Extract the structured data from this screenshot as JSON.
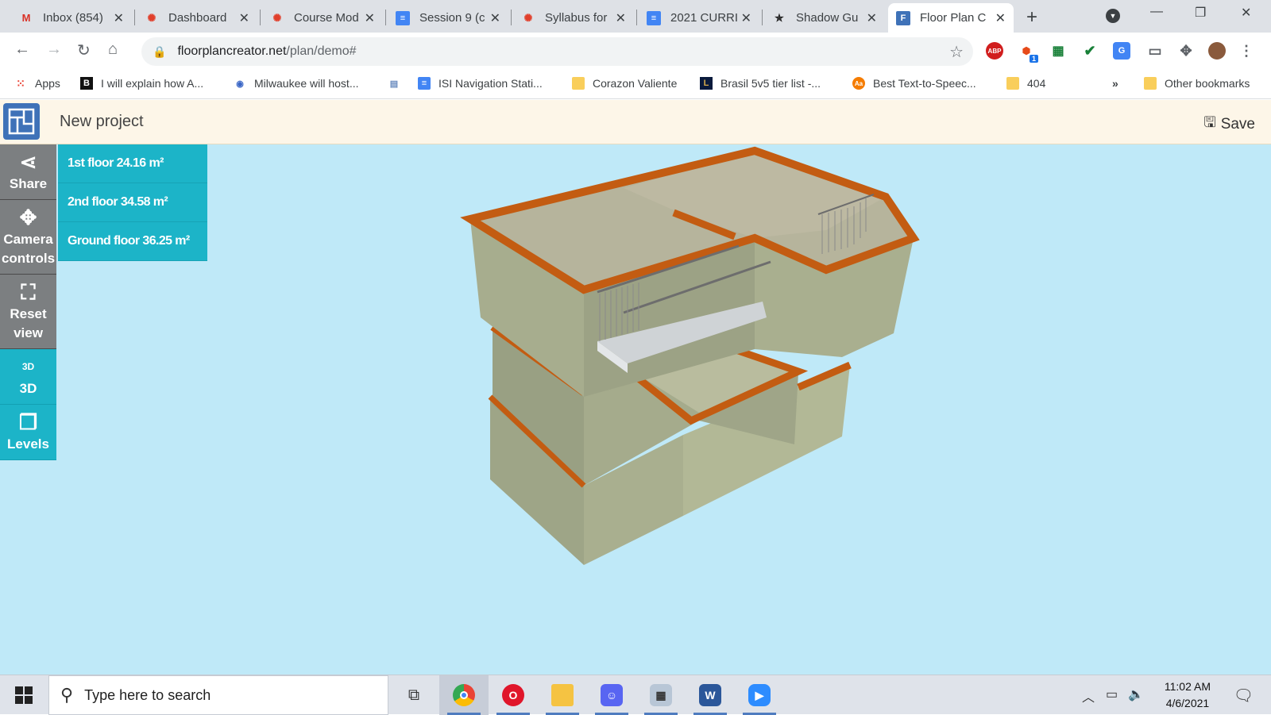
{
  "browser": {
    "tabs": [
      {
        "title": "Inbox (854)",
        "icon": "gmail-icon",
        "active": false
      },
      {
        "title": "Dashboard",
        "icon": "canvas-icon",
        "active": false
      },
      {
        "title": "Course Mod",
        "icon": "canvas-icon",
        "active": false
      },
      {
        "title": "Session 9 (c",
        "icon": "docs-icon",
        "active": false
      },
      {
        "title": "Syllabus for",
        "icon": "canvas-icon",
        "active": false
      },
      {
        "title": "2021 CURRI",
        "icon": "docs-icon",
        "active": false
      },
      {
        "title": "Shadow Gu",
        "icon": "star-logo-icon",
        "active": false
      },
      {
        "title": "Floor Plan C",
        "icon": "floorplan-icon",
        "active": true
      }
    ],
    "new_tab_label": "+",
    "url_host": "floorplancreator.net",
    "url_path": "/plan/demo#",
    "bookmarks": [
      {
        "label": "Apps",
        "icon": "apps-grid-icon"
      },
      {
        "label": "I will explain how A...",
        "icon": "b-icon"
      },
      {
        "label": "Milwaukee will host...",
        "icon": "globe-icon"
      },
      {
        "label": "",
        "icon": "page-icon"
      },
      {
        "label": "ISI Navigation Stati...",
        "icon": "docs-icon"
      },
      {
        "label": "Corazon Valiente",
        "icon": "folder-icon"
      },
      {
        "label": "Brasil 5v5 tier list -...",
        "icon": "league-icon"
      },
      {
        "label": "Best Text-to-Speec...",
        "icon": "tts-icon"
      },
      {
        "label": "404",
        "icon": "folder-icon"
      }
    ],
    "overflow_label": "»",
    "other_bookmarks": "Other bookmarks",
    "extensions": {
      "abp": "ABP",
      "badge": "1"
    }
  },
  "app": {
    "project_title": "New project",
    "save_label": "Save",
    "sidebar": [
      {
        "label": "Share",
        "icon": "share-icon"
      },
      {
        "label": "Camera controls",
        "icon": "camera-controls-icon"
      },
      {
        "label": "Reset view",
        "icon": "reset-view-icon"
      },
      {
        "label": "3D",
        "icon": "3d-rotate-icon",
        "icon_text": "3D"
      },
      {
        "label": "Levels",
        "icon": "levels-icon"
      }
    ],
    "floors": [
      {
        "label": "1st floor 24.16 m²"
      },
      {
        "label": "2nd floor 34.58 m²"
      },
      {
        "label": "Ground floor 36.25 m²"
      }
    ],
    "colors": {
      "teal": "#1cb4c8",
      "gray": "#7c7f81",
      "sky": "#bfe9f8",
      "wall": "#a5ab8c",
      "wall_top": "#c35c12"
    }
  },
  "taskbar": {
    "search_placeholder": "Type here to search",
    "time": "11:02 AM",
    "date": "4/6/2021",
    "apps": [
      "task-view-icon",
      "chrome-icon",
      "opera-icon",
      "file-explorer-icon",
      "discord-icon",
      "app-icon",
      "word-icon",
      "zoom-icon"
    ]
  }
}
